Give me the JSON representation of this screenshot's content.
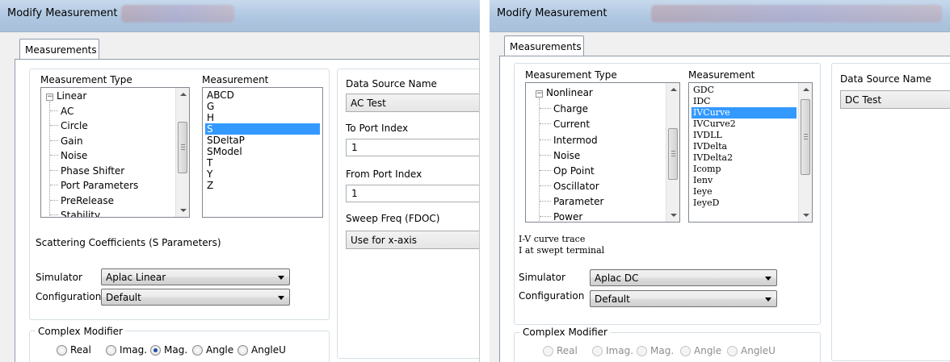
{
  "left_dialog": {
    "title": "Modify Measurement",
    "tab_label": "Measurements",
    "measurement_type_label": "Measurement Type",
    "measurement_label": "Measurement",
    "tree": {
      "root": "Linear",
      "children": [
        "AC",
        "Circle",
        "Gain",
        "Noise",
        "Phase Shifter",
        "Port Parameters",
        "PreRelease",
        "Stability"
      ]
    },
    "measurements": [
      "ABCD",
      "G",
      "H",
      "S",
      "SDeltaP",
      "SModel",
      "T",
      "Y",
      "Z"
    ],
    "selected_measurement": "S",
    "description": "Scattering Coefficients (S Parameters)",
    "simulator_label": "Simulator",
    "simulator_value": "Aplac Linear",
    "configuration_label": "Configuration",
    "configuration_value": "Default",
    "data_source_label": "Data Source Name",
    "data_source_value": "AC Test",
    "to_port_label": "To Port Index",
    "to_port_value": "1",
    "from_port_label": "From Port Index",
    "from_port_value": "1",
    "sweep_label": "Sweep Freq (FDOC)",
    "sweep_value": "Use for x-axis",
    "complex_modifier_label": "Complex Modifier",
    "modifiers": [
      "Real",
      "Imag.",
      "Mag.",
      "Angle",
      "AngleU"
    ],
    "selected_modifier": "Mag."
  },
  "right_dialog": {
    "title": "Modify Measurement",
    "tab_label": "Measurements",
    "measurement_type_label": "Measurement Type",
    "measurement_label": "Measurement",
    "tree": {
      "root": "Nonlinear",
      "children": [
        "Charge",
        "Current",
        "Intermod",
        "Noise",
        "Op Point",
        "Oscillator",
        "Parameter",
        "Power"
      ]
    },
    "measurements": [
      "GDC",
      "IDC",
      "IVCurve",
      "IVCurve2",
      "IVDLL",
      "IVDelta",
      "IVDelta2",
      "Icomp",
      "Ienv",
      "Ieye",
      "IeyeD"
    ],
    "selected_measurement": "IVCurve",
    "description_line1": "I-V curve trace",
    "description_line2": "I at swept terminal",
    "simulator_label": "Simulator",
    "simulator_value": "Aplac DC",
    "configuration_label": "Configuration",
    "configuration_value": "Default",
    "data_source_label": "Data Source Name",
    "data_source_value": "DC Test",
    "complex_modifier_label": "Complex Modifier",
    "modifiers": [
      "Real",
      "Imag.",
      "Mag.",
      "Angle",
      "AngleU"
    ]
  }
}
